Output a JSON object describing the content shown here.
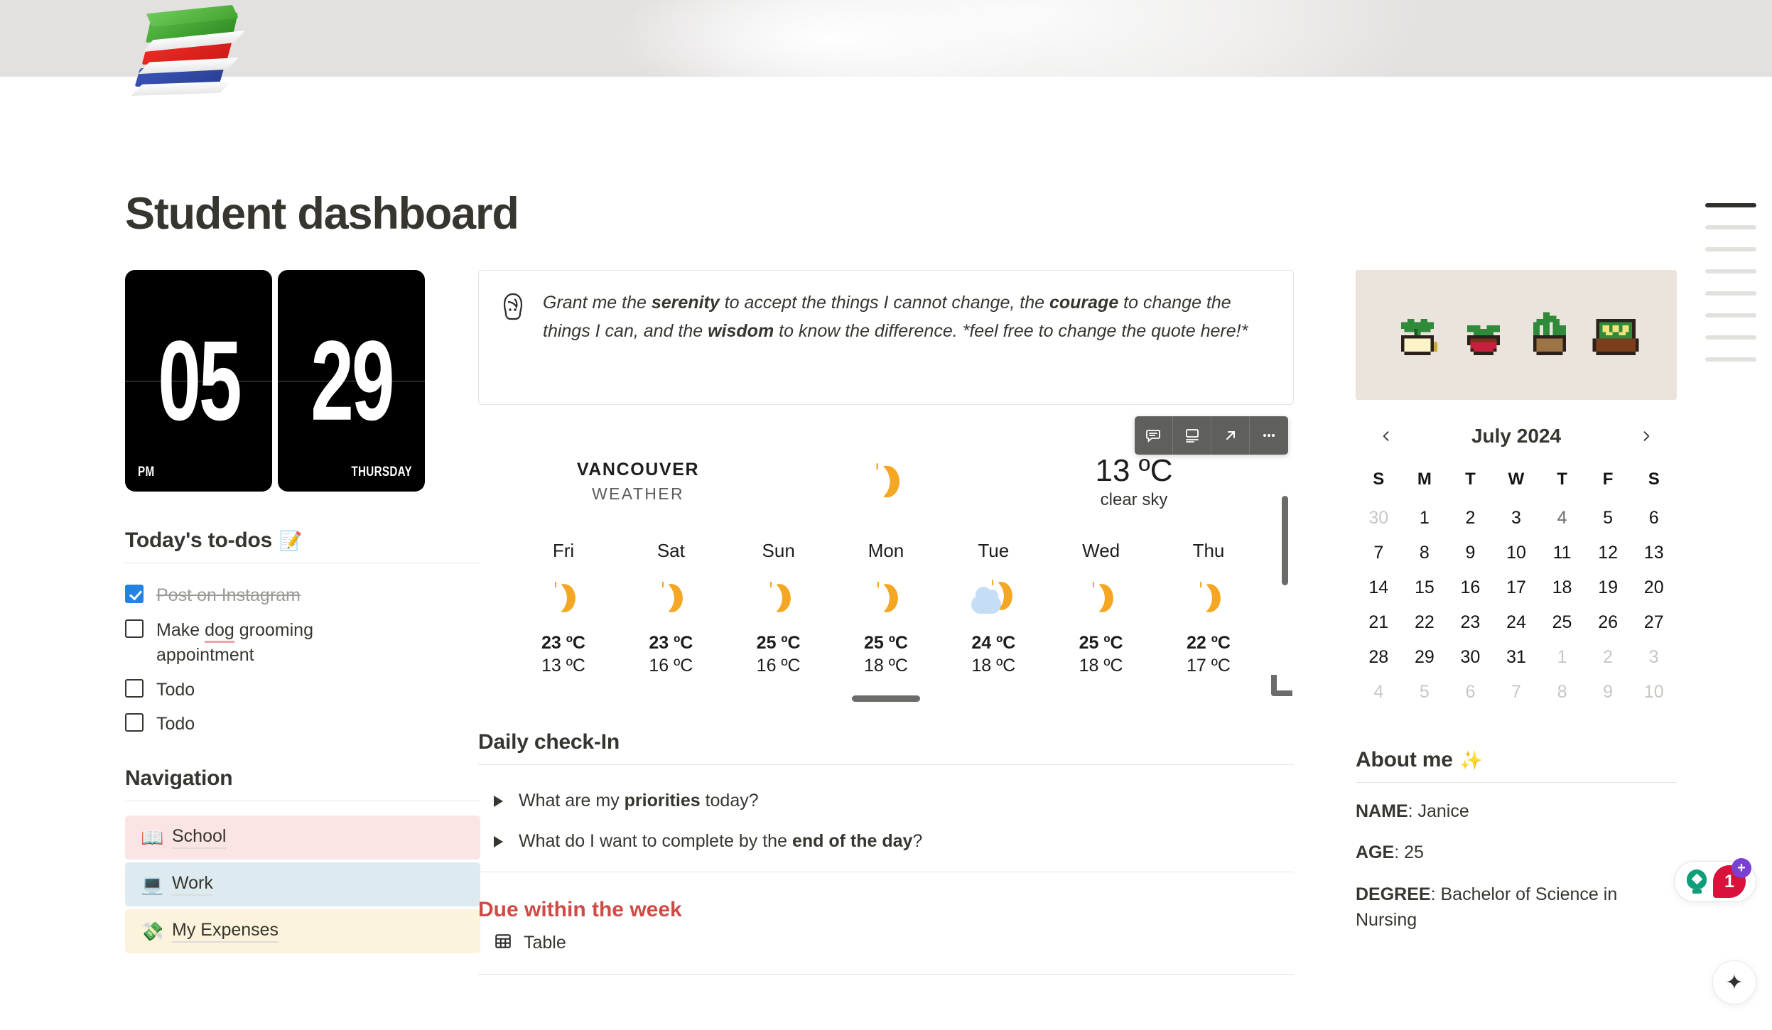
{
  "page": {
    "title": "Student dashboard",
    "icon": "books-stack-icon"
  },
  "clock": {
    "hour": "05",
    "meridiem": "PM",
    "day_number": "29",
    "weekday": "THURSDAY"
  },
  "todos": {
    "heading": "Today's to-dos",
    "heading_emoji": "📝",
    "items": [
      {
        "label": "Post on Instagram",
        "done": true
      },
      {
        "label": "Make dog grooming appointment",
        "done": false,
        "misspelled": "dog"
      },
      {
        "label": "Todo",
        "done": false
      },
      {
        "label": "Todo",
        "done": false
      }
    ]
  },
  "navigation": {
    "heading": "Navigation",
    "items": [
      {
        "label": "School",
        "emoji": "📖",
        "color": "#fbe4e4"
      },
      {
        "label": "Work",
        "emoji": "💻",
        "color": "#ddebf1"
      },
      {
        "label": "My Expenses",
        "emoji": "💸",
        "color": "#fbf3db"
      }
    ]
  },
  "quote": {
    "icon": "face-avatar-icon",
    "parts": [
      {
        "t": "Grant me the ",
        "b": false
      },
      {
        "t": "serenity",
        "b": true
      },
      {
        "t": " to accept the things I cannot change, the ",
        "b": false
      },
      {
        "t": "courage",
        "b": true
      },
      {
        "t": " to change the things I can, and the ",
        "b": false
      },
      {
        "t": "wisdom",
        "b": true
      },
      {
        "t": " to know the difference. *feel free to change the quote here!*",
        "b": false
      }
    ]
  },
  "weather": {
    "toolbar": [
      "comment-icon",
      "caption-icon",
      "expand-icon",
      "more-options-icon"
    ],
    "city": "VANCOUVER",
    "subtitle": "WEATHER",
    "current_icon": "clear-night-moon",
    "current_temp": "13 ºC",
    "current_desc": "clear sky",
    "forecast": [
      {
        "day": "Fri",
        "icon": "moon",
        "high": "23 ºC",
        "low": "13 ºC"
      },
      {
        "day": "Sat",
        "icon": "moon",
        "high": "23 ºC",
        "low": "16 ºC"
      },
      {
        "day": "Sun",
        "icon": "moon",
        "high": "25 ºC",
        "low": "16 ºC"
      },
      {
        "day": "Mon",
        "icon": "moon",
        "high": "25 ºC",
        "low": "18 ºC"
      },
      {
        "day": "Tue",
        "icon": "cloud-moon",
        "high": "24 ºC",
        "low": "18 ºC"
      },
      {
        "day": "Wed",
        "icon": "moon",
        "high": "25 ºC",
        "low": "18 ºC"
      },
      {
        "day": "Thu",
        "icon": "moon",
        "high": "22 ºC",
        "low": "17 ºC"
      }
    ]
  },
  "checkin": {
    "heading": "Daily check-In",
    "questions": [
      [
        {
          "t": "What are my ",
          "b": false
        },
        {
          "t": "priorities",
          "b": true
        },
        {
          "t": " today?",
          "b": false
        }
      ],
      [
        {
          "t": "What do I want to complete by the ",
          "b": false
        },
        {
          "t": "end of the day",
          "b": true
        },
        {
          "t": "?",
          "b": false
        }
      ]
    ]
  },
  "due": {
    "heading": "Due within the week",
    "table_label": "Table",
    "table_icon": "table-icon"
  },
  "calendar": {
    "month": "July 2024",
    "prev_icon": "chevron-left-icon",
    "next_icon": "chevron-right-icon",
    "dow": [
      "S",
      "M",
      "T",
      "W",
      "T",
      "F",
      "S"
    ],
    "weeks": [
      [
        {
          "d": "30",
          "s": "mute"
        },
        {
          "d": "1",
          "s": ""
        },
        {
          "d": "2",
          "s": ""
        },
        {
          "d": "3",
          "s": ""
        },
        {
          "d": "4",
          "s": "semi"
        },
        {
          "d": "5",
          "s": ""
        },
        {
          "d": "6",
          "s": ""
        }
      ],
      [
        {
          "d": "7",
          "s": ""
        },
        {
          "d": "8",
          "s": ""
        },
        {
          "d": "9",
          "s": ""
        },
        {
          "d": "10",
          "s": ""
        },
        {
          "d": "11",
          "s": ""
        },
        {
          "d": "12",
          "s": ""
        },
        {
          "d": "13",
          "s": ""
        }
      ],
      [
        {
          "d": "14",
          "s": ""
        },
        {
          "d": "15",
          "s": ""
        },
        {
          "d": "16",
          "s": ""
        },
        {
          "d": "17",
          "s": ""
        },
        {
          "d": "18",
          "s": ""
        },
        {
          "d": "19",
          "s": ""
        },
        {
          "d": "20",
          "s": ""
        }
      ],
      [
        {
          "d": "21",
          "s": ""
        },
        {
          "d": "22",
          "s": ""
        },
        {
          "d": "23",
          "s": ""
        },
        {
          "d": "24",
          "s": ""
        },
        {
          "d": "25",
          "s": ""
        },
        {
          "d": "26",
          "s": ""
        },
        {
          "d": "27",
          "s": ""
        }
      ],
      [
        {
          "d": "28",
          "s": ""
        },
        {
          "d": "29",
          "s": ""
        },
        {
          "d": "30",
          "s": ""
        },
        {
          "d": "31",
          "s": ""
        },
        {
          "d": "1",
          "s": "mute"
        },
        {
          "d": "2",
          "s": "mute"
        },
        {
          "d": "3",
          "s": "mute"
        }
      ],
      [
        {
          "d": "4",
          "s": "mute"
        },
        {
          "d": "5",
          "s": "mute"
        },
        {
          "d": "6",
          "s": "mute"
        },
        {
          "d": "7",
          "s": "mute"
        },
        {
          "d": "8",
          "s": "mute"
        },
        {
          "d": "9",
          "s": "mute"
        },
        {
          "d": "10",
          "s": "mute"
        }
      ]
    ]
  },
  "about": {
    "heading": "About me",
    "heading_emoji": "✨",
    "fields": [
      {
        "key": "NAME",
        "value": "Janice"
      },
      {
        "key": "AGE",
        "value": "25"
      },
      {
        "key": "DEGREE",
        "value": "Bachelor of Science in Nursing"
      }
    ]
  },
  "floating": {
    "help_badge_count": "1",
    "help_icon": "lightbulb-icon",
    "plus_icon": "plus-icon",
    "ai_icon": "sparkles-icon"
  },
  "colors": {
    "accent_blue": "#2383e2",
    "due_red": "#cf4b45",
    "weather_orange": "#f5a623",
    "plants_bg": "#eae4dc"
  }
}
